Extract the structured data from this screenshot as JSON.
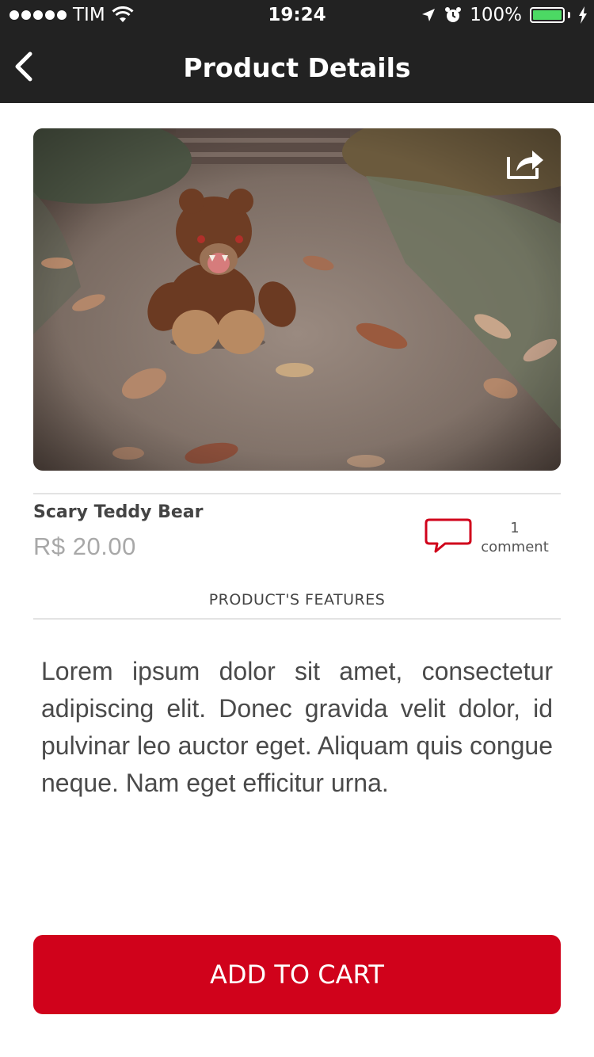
{
  "status_bar": {
    "carrier": "TIM",
    "time": "19:24",
    "battery": "100%",
    "battery_level": 1.0
  },
  "nav": {
    "title": "Product Details",
    "back_icon": "chevron-left-icon"
  },
  "product": {
    "share_icon": "share-icon",
    "name": "Scary Teddy Bear",
    "price": "R$ 20.00",
    "comment_icon": "comment-bubble-icon",
    "comment_count": "1",
    "comment_label": "comment"
  },
  "features": {
    "heading": "PRODUCT'S  FEATURES",
    "description": "Lorem ipsum dolor sit amet, consectetur adipiscing elit. Donec gravida velit dolor, id pulvinar leo auctor eget. Aliquam quis congue neque. Nam eget efficitur urna."
  },
  "actions": {
    "add_to_cart": "ADD TO CART"
  },
  "colors": {
    "nav_bg": "#222222",
    "accent": "#d0021b",
    "battery": "#4cd964"
  }
}
